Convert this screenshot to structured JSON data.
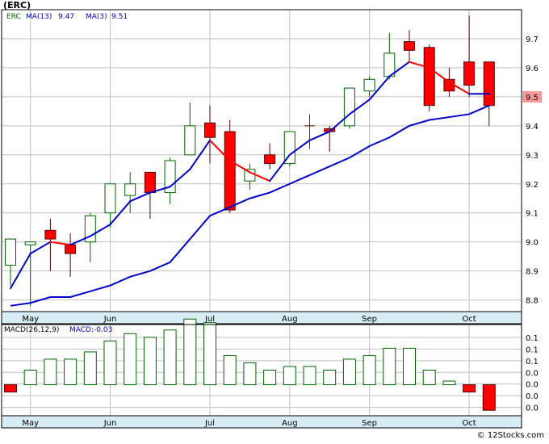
{
  "title": "(ERC)",
  "credit": "© 12Stocks.com",
  "colors": {
    "up_body": "#ffffff",
    "up_outline": "#006400",
    "down_body": "#ff0000",
    "down_outline": "#550000",
    "ma13": "#0000cc",
    "ma3_up": "#0000cc",
    "ma3_down": "#ff0000",
    "axis_band": "#d7ecf5",
    "grid": "#c0c0c0",
    "macd_pos": "#006400",
    "macd_neg": "#ff0000",
    "last_price_box": "#ff9999"
  },
  "chart_data": [
    {
      "type": "candlestick",
      "legend": {
        "ticker": "ERC",
        "ma13_label": "MA(13)",
        "ma13_value": "9.47",
        "ma3_label": "MA(3)",
        "ma3_value": "9.51"
      },
      "ylim": [
        8.76,
        9.8
      ],
      "yticks": [
        "8.8",
        "8.9",
        "9.0",
        "9.1",
        "9.2",
        "9.3",
        "9.4",
        "9.5",
        "9.6",
        "9.7"
      ],
      "last_price": "9.5",
      "xticks": [
        {
          "label": "May",
          "index": 1
        },
        {
          "label": "Jun",
          "index": 5
        },
        {
          "label": "Jul",
          "index": 10
        },
        {
          "label": "Aug",
          "index": 14
        },
        {
          "label": "Sep",
          "index": 18
        },
        {
          "label": "Oct",
          "index": 23
        }
      ],
      "candles": [
        {
          "o": 8.92,
          "h": 9.01,
          "l": 8.85,
          "c": 9.01
        },
        {
          "o": 8.99,
          "h": 9.0,
          "l": 8.78,
          "c": 9.0
        },
        {
          "o": 9.04,
          "h": 9.08,
          "l": 8.9,
          "c": 9.01
        },
        {
          "o": 8.99,
          "h": 9.03,
          "l": 8.88,
          "c": 8.96
        },
        {
          "o": 9.0,
          "h": 9.1,
          "l": 8.93,
          "c": 9.09
        },
        {
          "o": 9.1,
          "h": 9.2,
          "l": 9.05,
          "c": 9.2
        },
        {
          "o": 9.16,
          "h": 9.24,
          "l": 9.1,
          "c": 9.2
        },
        {
          "o": 9.24,
          "h": 9.24,
          "l": 9.08,
          "c": 9.17
        },
        {
          "o": 9.17,
          "h": 9.29,
          "l": 9.13,
          "c": 9.28
        },
        {
          "o": 9.3,
          "h": 9.48,
          "l": 9.3,
          "c": 9.4
        },
        {
          "o": 9.41,
          "h": 9.47,
          "l": 9.27,
          "c": 9.36
        },
        {
          "o": 9.38,
          "h": 9.42,
          "l": 9.1,
          "c": 9.11
        },
        {
          "o": 9.21,
          "h": 9.27,
          "l": 9.18,
          "c": 9.25
        },
        {
          "o": 9.3,
          "h": 9.34,
          "l": 9.25,
          "c": 9.27
        },
        {
          "o": 9.27,
          "h": 9.38,
          "l": 9.26,
          "c": 9.38
        },
        {
          "o": 9.4,
          "h": 9.44,
          "l": 9.32,
          "c": 9.4
        },
        {
          "o": 9.39,
          "h": 9.4,
          "l": 9.31,
          "c": 9.38
        },
        {
          "o": 9.4,
          "h": 9.53,
          "l": 9.39,
          "c": 9.53
        },
        {
          "o": 9.52,
          "h": 9.57,
          "l": 9.5,
          "c": 9.56
        },
        {
          "o": 9.57,
          "h": 9.72,
          "l": 9.56,
          "c": 9.65
        },
        {
          "o": 9.69,
          "h": 9.73,
          "l": 9.62,
          "c": 9.66
        },
        {
          "o": 9.67,
          "h": 9.68,
          "l": 9.45,
          "c": 9.47
        },
        {
          "o": 9.56,
          "h": 9.6,
          "l": 9.5,
          "c": 9.52
        },
        {
          "o": 9.62,
          "h": 9.78,
          "l": 9.5,
          "c": 9.54
        },
        {
          "o": 9.62,
          "h": 9.62,
          "l": 9.4,
          "c": 9.47
        }
      ],
      "ma13": [
        8.78,
        8.79,
        8.81,
        8.81,
        8.83,
        8.85,
        8.88,
        8.9,
        8.93,
        9.01,
        9.09,
        9.12,
        9.15,
        9.17,
        9.2,
        9.23,
        9.26,
        9.29,
        9.33,
        9.36,
        9.4,
        9.42,
        9.43,
        9.44,
        9.47
      ],
      "ma3": [
        8.84,
        8.96,
        9.0,
        8.99,
        9.02,
        9.06,
        9.14,
        9.17,
        9.19,
        9.25,
        9.35,
        9.28,
        9.24,
        9.21,
        9.3,
        9.35,
        9.38,
        9.44,
        9.49,
        9.57,
        9.62,
        9.6,
        9.55,
        9.51,
        9.51
      ]
    },
    {
      "type": "bar",
      "title": "MACD(26,12,9)",
      "value_label": "MACD:-0.03",
      "yticks": [
        "0.1",
        "0.1",
        "0.1",
        "0.0",
        "0.0",
        "0.0",
        "0.0",
        "0.0"
      ],
      "ylim": [
        -0.085,
        0.165
      ],
      "values": [
        -0.02,
        0.04,
        0.07,
        0.07,
        0.09,
        0.12,
        0.14,
        0.13,
        0.15,
        0.18,
        0.17,
        0.08,
        0.06,
        0.04,
        0.05,
        0.05,
        0.04,
        0.07,
        0.08,
        0.1,
        0.1,
        0.04,
        0.01,
        -0.02,
        -0.07
      ]
    }
  ]
}
